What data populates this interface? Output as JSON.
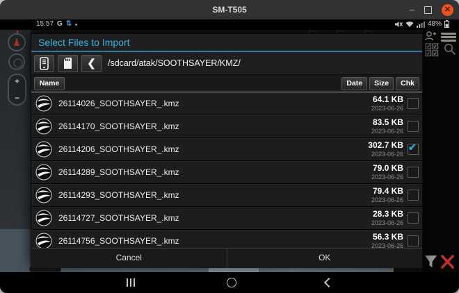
{
  "window": {
    "title": "SM-T505",
    "minimize_glyph": "–",
    "close_glyph": "✕"
  },
  "statusbar": {
    "time": "15:57",
    "carrier": "G",
    "sync_glyph": "⇅",
    "battery": "48%"
  },
  "dialog": {
    "title": "Select Files to Import",
    "path": "/sdcard/atak/SOOTHSAYER/KMZ/",
    "back_glyph": "❮",
    "columns": {
      "name": "Name",
      "date": "Date",
      "size": "Size",
      "chk": "Chk"
    },
    "files": [
      {
        "name": "26114026_SOOTHSAYER_.kmz",
        "size": "64.1 KB",
        "date": "2023-06-26",
        "checked": false
      },
      {
        "name": "26114170_SOOTHSAYER_.kmz",
        "size": "83.5 KB",
        "date": "2023-06-26",
        "checked": false
      },
      {
        "name": "26114206_SOOTHSAYER_.kmz",
        "size": "302.7 KB",
        "date": "2023-06-26",
        "checked": true
      },
      {
        "name": "26114289_SOOTHSAYER_.kmz",
        "size": "79.0 KB",
        "date": "2023-06-26",
        "checked": false
      },
      {
        "name": "26114293_SOOTHSAYER_.kmz",
        "size": "79.4 KB",
        "date": "2023-06-26",
        "checked": false
      },
      {
        "name": "26114727_SOOTHSAYER_.kmz",
        "size": "28.3 KB",
        "date": "2023-06-26",
        "checked": false
      },
      {
        "name": "26114756_SOOTHSAYER_.kmz",
        "size": "56.3 KB",
        "date": "2023-06-26",
        "checked": false
      }
    ],
    "buttons": {
      "cancel": "Cancel",
      "ok": "OK"
    }
  },
  "map_controls": {
    "zoom_in_glyph": "+",
    "zoom_out_glyph": "−"
  },
  "icons": {
    "check": "✔"
  },
  "colors": {
    "accent": "#33b5e5",
    "title_blue": "#35b6e9",
    "close_button": "#e9541f",
    "delete_red": "#c03028"
  }
}
